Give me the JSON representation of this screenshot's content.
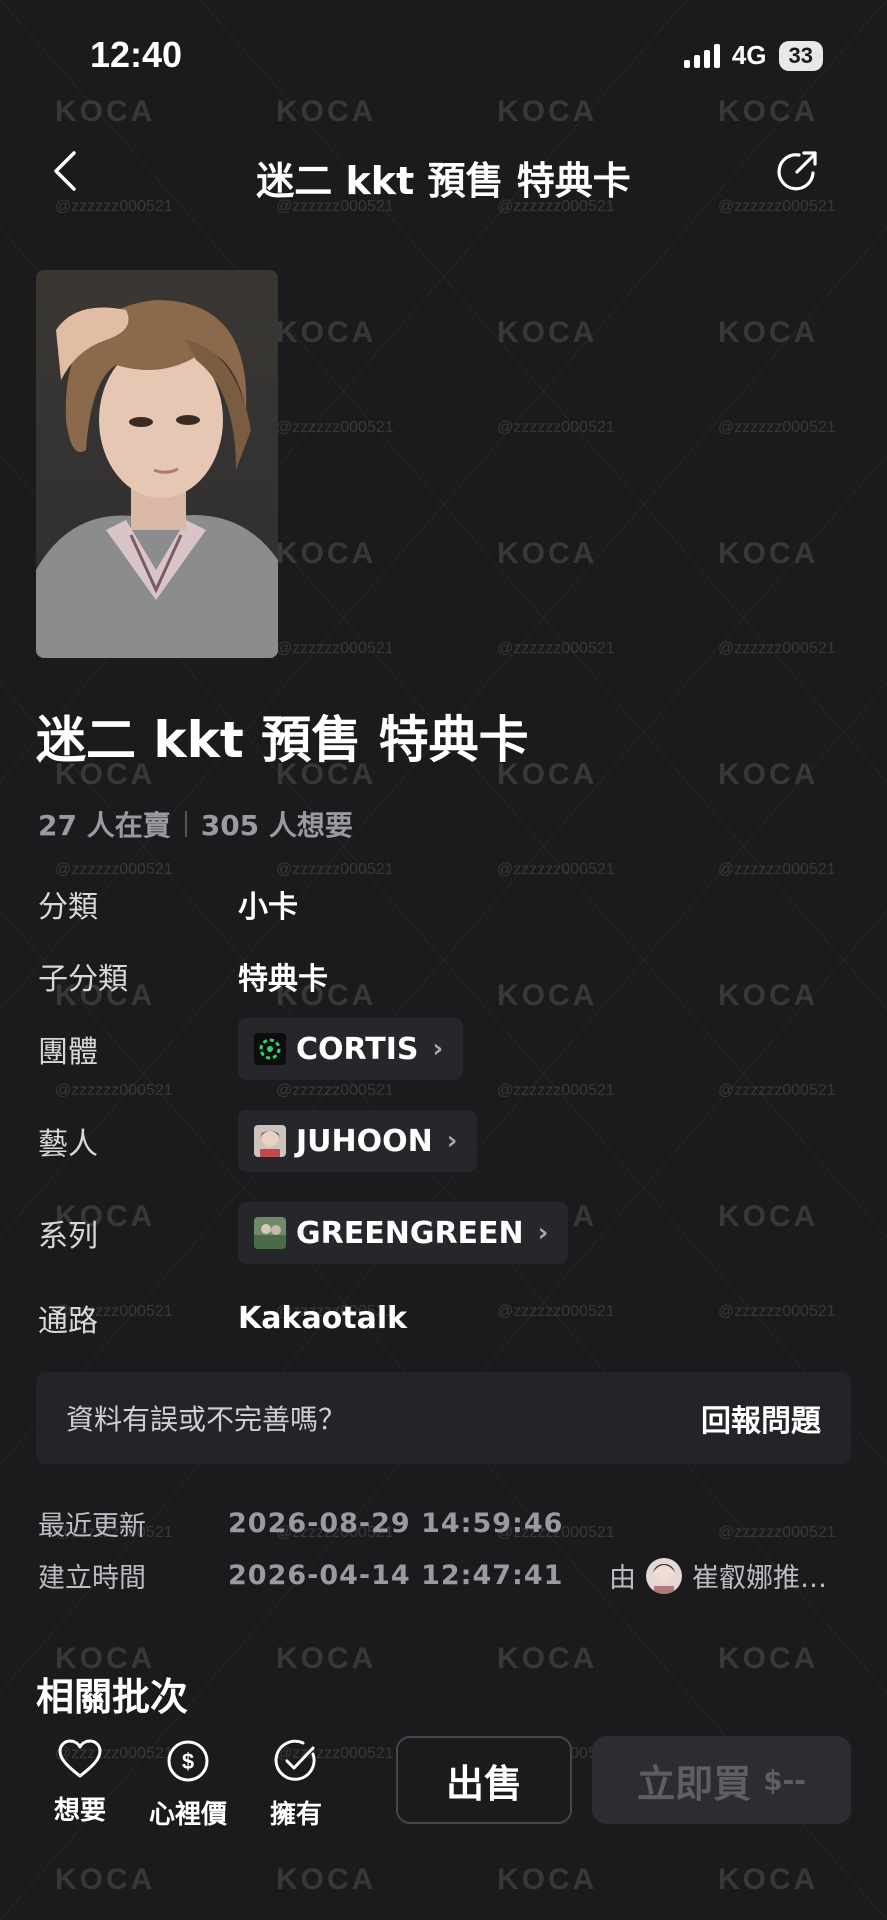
{
  "status_bar": {
    "time": "12:40",
    "network": "4G",
    "battery": "33"
  },
  "nav": {
    "title": "迷二 kkt 預售 特典卡",
    "back_icon": "chevron-left-icon",
    "share_icon": "share-icon"
  },
  "watermark": {
    "logo": "KOCA",
    "handle": "@zzzzzz000521"
  },
  "product": {
    "title": "迷二 kkt 預售 特典卡",
    "selling": "27 人在賣",
    "wanting": "305 人想要"
  },
  "attributes": {
    "category": {
      "label": "分類",
      "value": "小卡"
    },
    "subcategory": {
      "label": "子分類",
      "value": "特典卡"
    },
    "group": {
      "label": "團體",
      "value": "CORTIS"
    },
    "artist": {
      "label": "藝人",
      "value": "JUHOON"
    },
    "series": {
      "label": "系列",
      "value": "GREENGREEN"
    },
    "channel": {
      "label": "通路",
      "value": "Kakaotalk"
    }
  },
  "report": {
    "question": "資料有誤或不完善嗎？",
    "link": "回報問題"
  },
  "meta": {
    "updated_label": "最近更新",
    "updated_value": "2026-08-29 14:59:46",
    "created_label": "建立時間",
    "created_value": "2026-04-14 12:47:41",
    "by_label": "由",
    "creator": "崔叡娜推…"
  },
  "related": {
    "title": "相關批次"
  },
  "bottom_bar": {
    "want": "想要",
    "price": "心裡價",
    "own": "擁有",
    "sell": "出售",
    "buy": "立即買",
    "buy_price": "$--"
  },
  "colors": {
    "background": "#1b1b1d",
    "accent_green": "#2fd36b",
    "muted": "#9a9aa0"
  }
}
